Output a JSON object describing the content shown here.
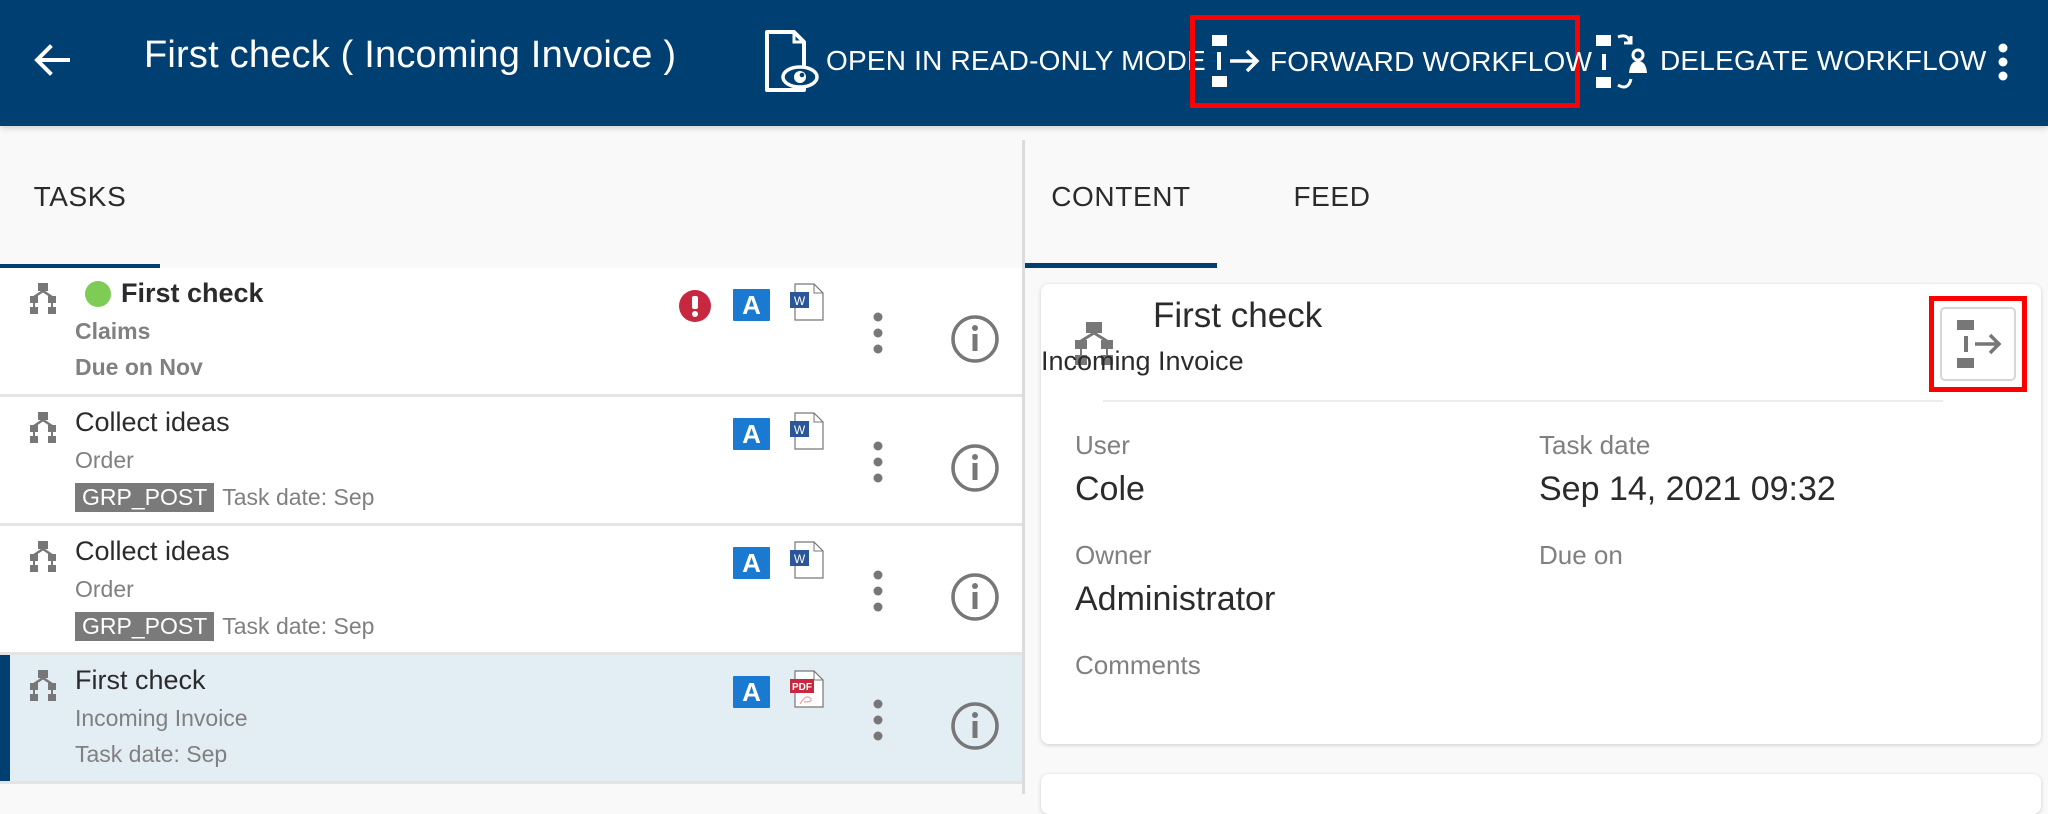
{
  "appbar": {
    "title": "First check ( Incoming Invoice )",
    "actions": {
      "read_only": "OPEN IN READ-ONLY MODE",
      "forward": "FORWARD WORKFLOW",
      "delegate": "DELEGATE WORKFLOW"
    },
    "icons": {
      "back": "arrow-left-icon",
      "read_only": "document-eye-icon",
      "forward": "forward-workflow-icon",
      "delegate": "delegate-workflow-icon",
      "more": "more-vertical-icon"
    }
  },
  "left_panel": {
    "tab": "TASKS",
    "tasks": [
      {
        "title": "First check",
        "bold": true,
        "status_color": "#7ccc55",
        "line2": "Claims",
        "line3": "Due on Nov",
        "priority_icon": "exclamation-icon",
        "badge": "A",
        "doc_type": "word",
        "doc_label": "W"
      },
      {
        "title": "Collect ideas",
        "line2": "Order",
        "group": "GRP_POST",
        "line3": "Task date: Sep",
        "badge": "A",
        "doc_type": "word",
        "doc_label": "W"
      },
      {
        "title": "Collect ideas",
        "line2": "Order",
        "group": "GRP_POST",
        "line3": "Task date: Sep",
        "badge": "A",
        "doc_type": "word",
        "doc_label": "W"
      },
      {
        "title": "First check",
        "line2": "Incoming Invoice",
        "line3": "Task date: Sep",
        "badge": "A",
        "doc_type": "pdf",
        "doc_label": "PDF",
        "selected": true
      }
    ]
  },
  "right_panel": {
    "tabs": [
      "CONTENT",
      "FEED"
    ],
    "active_tab": "CONTENT",
    "card": {
      "title": "First check",
      "subtitle": "Incoming Invoice",
      "fields": {
        "user_label": "User",
        "user_value": "Cole",
        "task_date_label": "Task date",
        "task_date_value": "Sep 14, 2021 09:32",
        "owner_label": "Owner",
        "owner_value": "Administrator",
        "due_on_label": "Due on",
        "due_on_value": "",
        "comments_label": "Comments"
      }
    }
  },
  "colors": {
    "appbar": "#003f72",
    "accent": "#003f72",
    "highlight": "#ff0000",
    "badge_blue": "#1a79d0",
    "priority_red": "#c8283f",
    "status_green": "#7ccc55",
    "selected_row": "#e3edf4"
  }
}
